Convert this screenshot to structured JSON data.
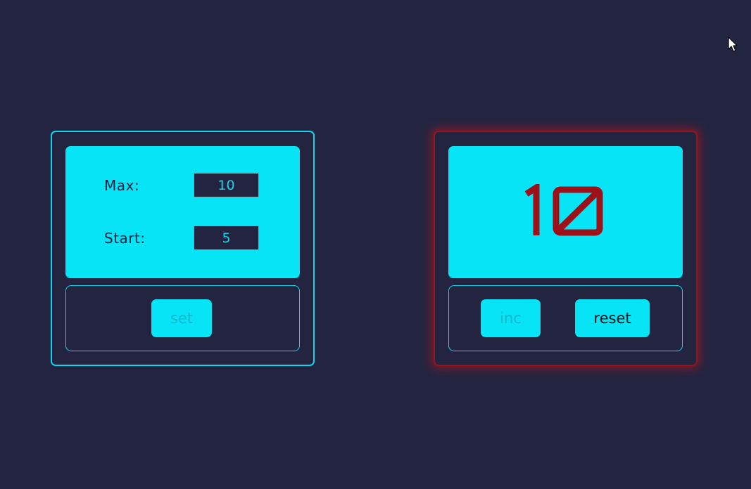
{
  "settings": {
    "max_label": "Max:",
    "max_value": "10",
    "start_label": "Start:",
    "start_value": "5",
    "set_label": "set",
    "set_disabled": true
  },
  "counter": {
    "value": "10",
    "at_max": true,
    "inc_label": "inc",
    "inc_disabled": true,
    "reset_label": "reset",
    "reset_disabled": false
  },
  "colors": {
    "background": "#232540",
    "accent": "#07e4f5",
    "border": "#16d2ec",
    "alert": "#9c1218"
  },
  "icons": {
    "cursor": "mouse-pointer-icon"
  }
}
